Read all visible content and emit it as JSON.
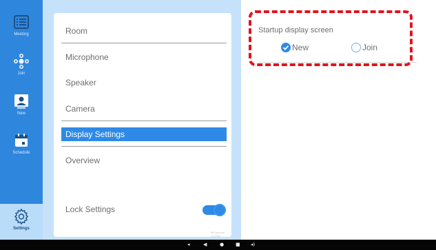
{
  "nav_rail": {
    "items": [
      {
        "label": "Meeting",
        "icon": "list-icon"
      },
      {
        "label": "Join",
        "icon": "join-icon"
      },
      {
        "label": "New",
        "icon": "person-icon"
      },
      {
        "label": "Schedule",
        "icon": "calendar-icon"
      },
      {
        "label": "Settings",
        "icon": "gear-icon",
        "active": true
      }
    ]
  },
  "settings_menu": {
    "items": [
      {
        "label": "Room"
      },
      {
        "label": "Microphone"
      },
      {
        "label": "Speaker"
      },
      {
        "label": "Camera"
      },
      {
        "label": "Display Settings",
        "selected": true
      },
      {
        "label": "Overview"
      }
    ],
    "lock_label": "Lock Settings",
    "lock_enabled": true,
    "version": "MS.version 1.5.Part"
  },
  "display_settings": {
    "title": "Startup display screen",
    "options": [
      {
        "label": "New",
        "checked": true
      },
      {
        "label": "Join",
        "checked": false
      }
    ]
  },
  "colors": {
    "accent": "#2e8ae6",
    "rail": "#2f86dd",
    "highlight": "#e0141e"
  },
  "system_bar": {
    "buttons": [
      "volume-down-icon",
      "back-icon",
      "home-icon",
      "recents-icon",
      "volume-up-icon"
    ]
  }
}
